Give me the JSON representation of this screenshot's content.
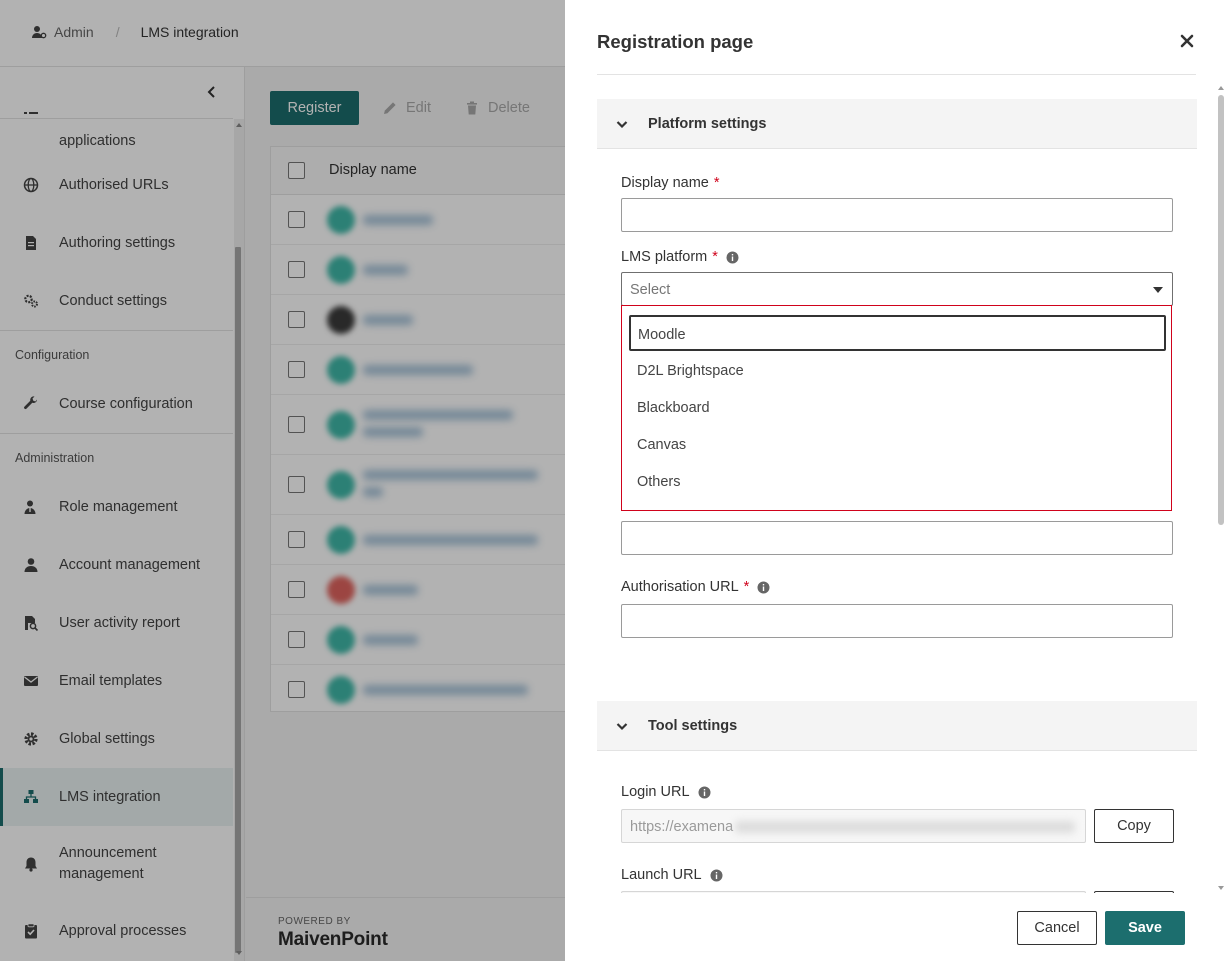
{
  "breadcrumb": {
    "home": "Admin",
    "separator": "/",
    "current": "LMS integration"
  },
  "sidebar": {
    "items_top": [
      {
        "label": "applications",
        "icon": "list-icon"
      },
      {
        "label": "Authorised URLs",
        "icon": "globe-icon"
      },
      {
        "label": "Authoring settings",
        "icon": "document-icon"
      },
      {
        "label": "Conduct settings",
        "icon": "gears-icon"
      }
    ],
    "section_configuration": "Configuration",
    "items_configuration": [
      {
        "label": "Course configuration",
        "icon": "wrench-icon"
      }
    ],
    "section_administration": "Administration",
    "items_administration": [
      {
        "label": "Role management",
        "icon": "user-key-icon"
      },
      {
        "label": "Account management",
        "icon": "user-icon"
      },
      {
        "label": "User activity report",
        "icon": "report-search-icon"
      },
      {
        "label": "Email templates",
        "icon": "envelope-icon"
      },
      {
        "label": "Global settings",
        "icon": "gear-icon"
      },
      {
        "label": "LMS integration",
        "icon": "network-icon",
        "active": true
      },
      {
        "label": "Announcement management",
        "icon": "bell-icon"
      },
      {
        "label": "Approval processes",
        "icon": "clipboard-check-icon"
      }
    ]
  },
  "toolbar": {
    "register": "Register",
    "edit": "Edit",
    "delete": "Delete"
  },
  "grid": {
    "column_display_name": "Display name",
    "row_count": 10
  },
  "footer": {
    "powered_by": "POWERED BY",
    "brand": "MaivenPoint"
  },
  "drawer": {
    "title": "Registration page",
    "platform_section": "Platform settings",
    "display_name_label": "Display name",
    "display_name_value": "",
    "lms_platform_label": "LMS platform",
    "lms_platform_placeholder": "Select",
    "lms_options": [
      "Moodle",
      "D2L Brightspace",
      "Blackboard",
      "Canvas",
      "Others"
    ],
    "lms_focused_option": "Moodle",
    "hidden_field_value": "",
    "auth_url_label": "Authorisation URL",
    "auth_url_value": "",
    "tool_section": "Tool settings",
    "login_url_label": "Login URL",
    "login_url_value": "https://examena",
    "copy_label": "Copy",
    "launch_url_label": "Launch URL",
    "required_mark": "*",
    "cancel": "Cancel",
    "save": "Save"
  },
  "colors": {
    "accent": "#1c6e6e",
    "required": "#d0021b",
    "dropdown_border": "#d0021b"
  }
}
